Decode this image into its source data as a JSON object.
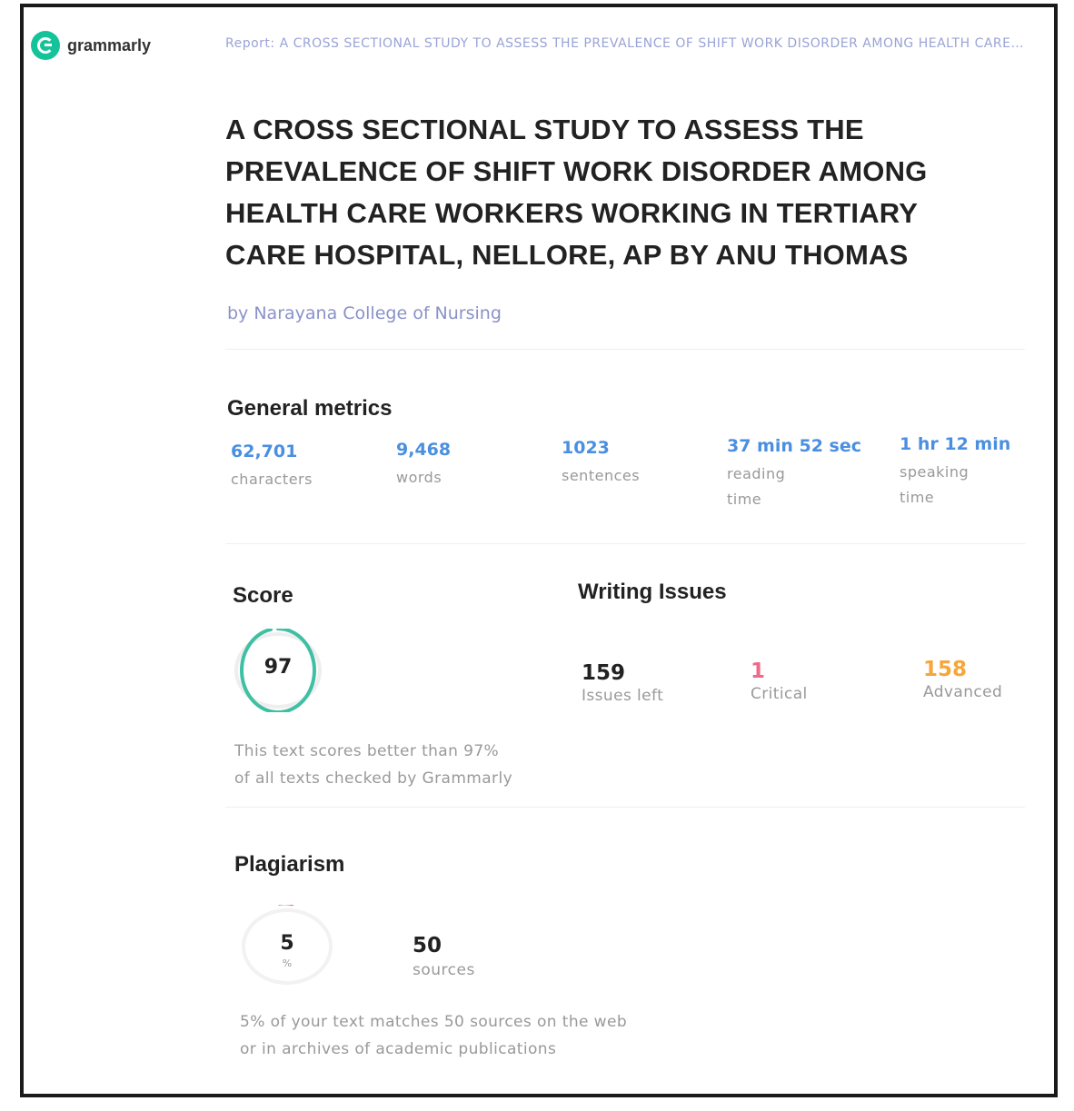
{
  "brand": {
    "name": "grammarly",
    "icon": "grammarly-logo-icon",
    "color": "#15c39a"
  },
  "report_line": "Report: A CROSS SECTIONAL STUDY TO ASSESS THE PREVALENCE OF SHIFT WORK DISORDER AMONG HEALTH CARE WORKERS WORKING IN TERTIARY CARE HOSPITAL, NELLORE, AP BY ANU THOMAS",
  "title_lines": [
    "A CROSS SECTIONAL STUDY TO ASSESS THE",
    "PREVALENCE OF SHIFT WORK DISORDER AMONG",
    "HEALTH CARE WORKERS WORKING IN TERTIARY",
    "CARE HOSPITAL, NELLORE, AP BY ANU THOMAS"
  ],
  "byline": "by Narayana College of Nursing",
  "general_metrics": {
    "heading": "General metrics",
    "items": [
      {
        "value": "62,701",
        "label": "characters"
      },
      {
        "value": "9,468",
        "label": "words"
      },
      {
        "value": "1023",
        "label": "sentences"
      },
      {
        "value": "37 min 52 sec",
        "label_lines": [
          "reading",
          "time"
        ]
      },
      {
        "value": "1 hr 12 min",
        "label_lines": [
          "speaking",
          "time"
        ]
      }
    ]
  },
  "score": {
    "heading": "Score",
    "value": "97",
    "ring_fraction": 0.97,
    "ring_color": "#3fbfa4",
    "desc_lines": [
      "This text scores better than 97%",
      "of all texts checked by Grammarly"
    ]
  },
  "writing_issues": {
    "heading": "Writing Issues",
    "items": [
      {
        "value": "159",
        "label": "Issues left",
        "color": "#222222"
      },
      {
        "value": "1",
        "label": "Critical",
        "color": "#ee6a8a"
      },
      {
        "value": "158",
        "label": "Advanced",
        "color": "#f6a63a"
      }
    ]
  },
  "plagiarism": {
    "heading": "Plagiarism",
    "value": "5",
    "unit": "%",
    "ring_fraction": 0.05,
    "ring_color": "#d667d6",
    "sources_value": "50",
    "sources_label": "sources",
    "desc_lines": [
      "5% of your text matches 50 sources on the web",
      "or in archives of academic publications"
    ]
  }
}
